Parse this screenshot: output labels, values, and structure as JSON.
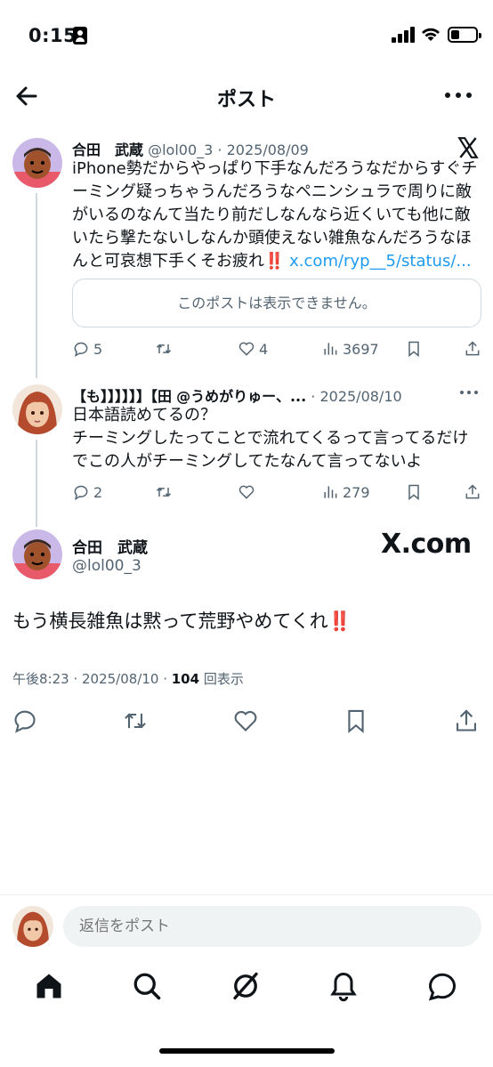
{
  "status_bar": {
    "time": "0:15",
    "battery_level": 0.35
  },
  "header": {
    "title": "ポスト"
  },
  "posts": [
    {
      "name": "合田　武蔵",
      "handle": "@lol00_3",
      "date": "· 2025/08/09",
      "text": "iPhone勢だからやっぱり下手なんだろうなだからすぐチーミング疑っちゃうんだろうなペニンシュラで周りに敵がいるのなんて当たり前だしなんなら近くいても他に敵いたら撃たないしなんか頭使えない雑魚なんだろうなほんと可哀想下手くそお疲れ",
      "emoji": "‼️",
      "link": "x.com/ryp__5/status/...",
      "quote": "このポストは表示できません。",
      "replies": "5",
      "retweets": "",
      "likes": "4",
      "views": "3697"
    },
    {
      "name": "【も】】】】】】【田",
      "handle": "@うめがりゅー、...",
      "date": "· 2025/08/10",
      "text_line1": "日本語読めてるの？",
      "text_line2": "チーミングしたってことで流れてくるって言ってるだけでこの人がチーミングしてたなんて言ってないよ",
      "replies": "2",
      "retweets": "",
      "likes": "",
      "views": "279"
    }
  ],
  "main_post": {
    "name": "合田　武蔵",
    "handle": "@lol00_3",
    "watermark": "X.com",
    "text": "もう横長雑魚は黙って荒野やめてくれ",
    "emoji": "‼️",
    "time": "午後8:23 · 2025/08/10 · ",
    "view_count": "104",
    "view_label": " 回表示"
  },
  "reply_box": {
    "placeholder": "返信をポスト"
  },
  "colors": {
    "link": "#1d9bf0",
    "muted": "#536471",
    "text": "#0f1419",
    "border": "#cfd9de"
  }
}
